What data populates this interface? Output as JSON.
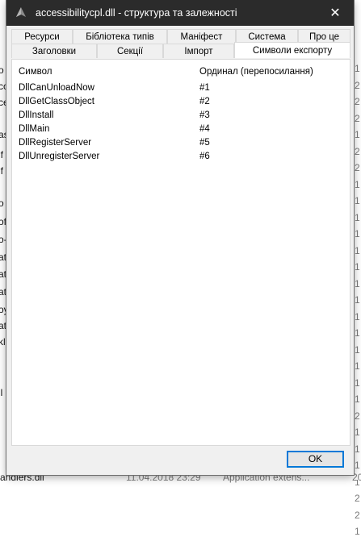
{
  "window": {
    "title": "accessibilitycpl.dll - структура та залежності",
    "close_glyph": "✕"
  },
  "tabs": {
    "row_top": [
      "Ресурси",
      "Бібліотека типів",
      "Маніфест",
      "Система",
      "Про це"
    ],
    "row_bottom": [
      "Заголовки",
      "Секції",
      "Імпорт",
      "Символи експорту"
    ],
    "active": "Символи експорту"
  },
  "exports": {
    "columns": [
      "Символ",
      "Ординал (перепосилання)"
    ],
    "rows": [
      {
        "symbol": "DllCanUnloadNow",
        "ordinal": "#1"
      },
      {
        "symbol": "DllGetClassObject",
        "ordinal": "#2"
      },
      {
        "symbol": "DllInstall",
        "ordinal": "#3"
      },
      {
        "symbol": "DllMain",
        "ordinal": "#4"
      },
      {
        "symbol": "DllRegisterServer",
        "ordinal": "#5"
      },
      {
        "symbol": "DllUnregisterServer",
        "ordinal": "#6"
      }
    ]
  },
  "buttons": {
    "ok": "OK"
  },
  "background": {
    "left_fragments": [
      "o",
      "cc",
      "ce",
      "as",
      "if",
      "if",
      "o",
      "of",
      "o-",
      "at",
      "at",
      "at",
      "oy",
      "at",
      "kl",
      "ll"
    ],
    "right_fragments": [
      "1",
      "2",
      "2",
      "2",
      "1",
      "2",
      "2",
      "1",
      "1",
      "1",
      "1",
      "1",
      "1",
      "1",
      "1",
      "1",
      "1",
      "1",
      "1",
      "1",
      "1",
      "2",
      "1",
      "1",
      "1",
      "1",
      "2",
      "2",
      "1"
    ],
    "bottom_row": {
      "name": "andlers.dll",
      "date": "11.04.2018 23:29",
      "type": "Application extens...",
      "size": "20"
    }
  },
  "colors": {
    "titlebar": "#2b2b2b",
    "dialog_bg": "#f0f0f0",
    "accent": "#0078d7"
  }
}
